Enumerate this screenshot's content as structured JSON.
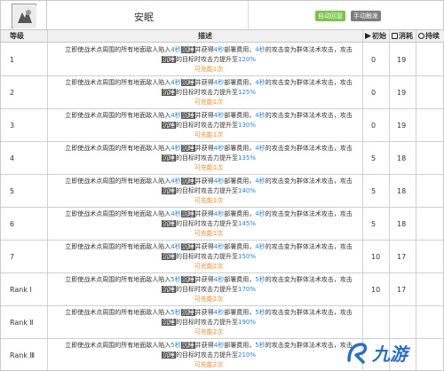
{
  "skill": {
    "name": "安眠"
  },
  "badges": {
    "auto_recover": "自动回复",
    "manual_trigger": "手动触发"
  },
  "columns": {
    "level": "等级",
    "description": "描述",
    "initial": "初始",
    "cost": "消耗",
    "duration": "持续"
  },
  "common": {
    "prefix": "立即使战术点周围的所有地面敌人陷入",
    "sleep_suffix": "秒",
    "kw_sleep": "沉睡",
    "mid": "并获得",
    "charge_suffix": "秒",
    "kw_mechanic": "部署费用",
    "after_charge": "，",
    "effect": "内获得",
    "attack_change": "的攻击变为群体法术攻击，攻击",
    "target": "对目标",
    "target2": "的目标时攻击力提升至",
    "tail": "可充能"
  },
  "rows": [
    {
      "level": "1",
      "sleep": "4秒",
      "deploy": "4秒",
      "dur": "4秒",
      "atk": "120%",
      "charges": "可充能1次",
      "initial": "0",
      "cost": "19",
      "duration": ""
    },
    {
      "level": "2",
      "sleep": "4秒",
      "deploy": "4秒",
      "dur": "4秒",
      "atk": "125%",
      "charges": "可充能1次",
      "initial": "0",
      "cost": "19",
      "duration": ""
    },
    {
      "level": "3",
      "sleep": "4秒",
      "deploy": "4秒",
      "dur": "4秒",
      "atk": "130%",
      "charges": "可充能1次",
      "initial": "0",
      "cost": "19",
      "duration": ""
    },
    {
      "level": "4",
      "sleep": "4秒",
      "deploy": "4秒",
      "dur": "4秒",
      "atk": "135%",
      "charges": "可充能1次",
      "initial": "5",
      "cost": "18",
      "duration": ""
    },
    {
      "level": "5",
      "sleep": "4秒",
      "deploy": "4秒",
      "dur": "4秒",
      "atk": "140%",
      "charges": "可充能1次",
      "initial": "5",
      "cost": "18",
      "duration": ""
    },
    {
      "level": "6",
      "sleep": "4秒",
      "deploy": "4秒",
      "dur": "4秒",
      "atk": "145%",
      "charges": "可充能1次",
      "initial": "5",
      "cost": "18",
      "duration": ""
    },
    {
      "level": "7",
      "sleep": "4秒",
      "deploy": "4秒",
      "dur": "4秒",
      "atk": "150%",
      "charges": "可充能2次",
      "initial": "10",
      "cost": "17",
      "duration": ""
    },
    {
      "level": "Rank Ⅰ",
      "sleep": "5秒",
      "deploy": "4秒",
      "dur": "5秒",
      "atk": "170%",
      "charges": "可充能2次",
      "initial": "10",
      "cost": "17",
      "duration": ""
    },
    {
      "level": "Rank Ⅱ",
      "sleep": "5秒",
      "deploy": "4秒",
      "dur": "5秒",
      "atk": "190%",
      "charges": "可充能2次",
      "initial": "",
      "cost": "",
      "duration": ""
    },
    {
      "level": "Rank Ⅲ",
      "sleep": "5秒",
      "deploy": "4秒",
      "dur": "5秒",
      "atk": "210%",
      "charges": "可充能2次",
      "initial": "",
      "cost": "",
      "duration": ""
    }
  ],
  "watermark": {
    "text": "九游"
  }
}
